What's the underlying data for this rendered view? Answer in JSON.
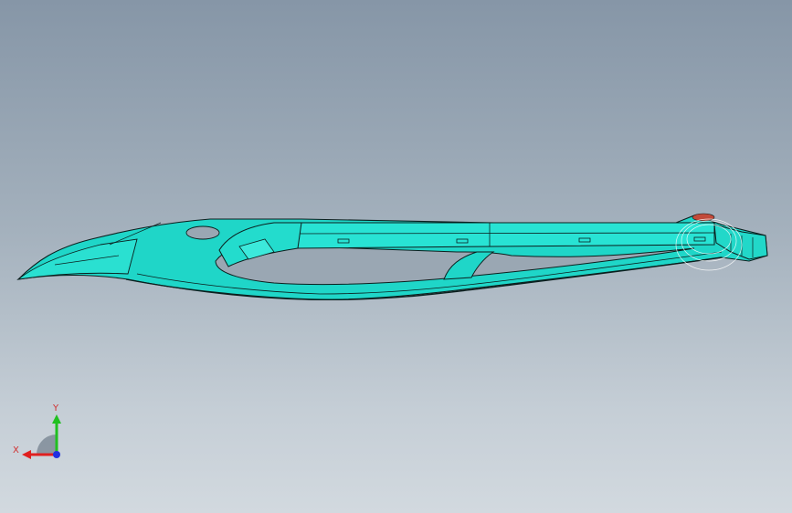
{
  "viewport": {
    "background_top": "#8696a7",
    "background_bottom": "#d2d9df"
  },
  "model": {
    "part_color": "#1fd6c8",
    "edge_color": "#0b1f1e",
    "highlight_color": "#c24a3a"
  },
  "triad": {
    "x_label": "X",
    "y_label": "Y",
    "x_color": "#e02020",
    "y_color": "#20c020",
    "z_color": "#2030e0",
    "icons": [
      "triad-x-arrow-icon",
      "triad-y-arrow-icon",
      "triad-z-origin-icon"
    ]
  }
}
